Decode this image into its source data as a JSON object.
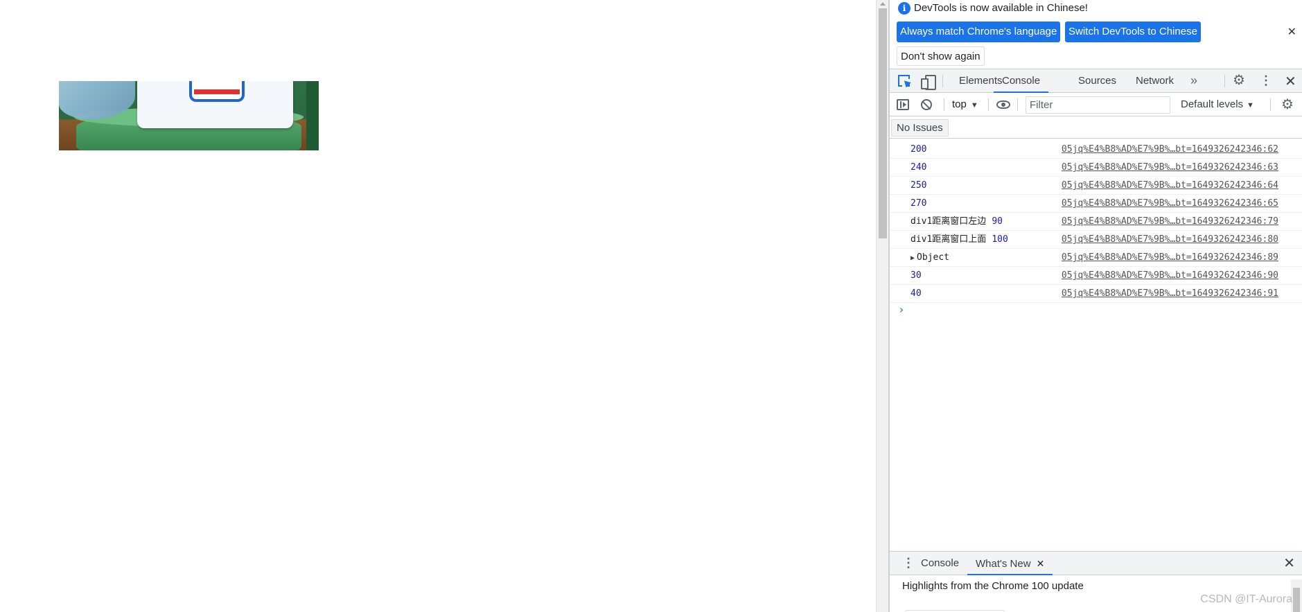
{
  "banner": {
    "message": "DevTools is now available in Chinese!",
    "match_button": "Always match Chrome's language",
    "switch_button": "Switch DevTools to Chinese",
    "dont_show_button": "Don't show again",
    "close": "✕"
  },
  "tabs": {
    "elements": "Elements",
    "console": "Console",
    "sources": "Sources",
    "network": "Network",
    "more": "»",
    "close": "✕"
  },
  "toolbar": {
    "context": "top",
    "filter_placeholder": "Filter",
    "levels": "Default levels"
  },
  "issues": {
    "label": "No Issues"
  },
  "console": {
    "messages": [
      {
        "label": "",
        "value": "200",
        "source": "05jq%E4%B8%AD%E7%9B%…bt=1649326242346:62"
      },
      {
        "label": "",
        "value": "240",
        "source": "05jq%E4%B8%AD%E7%9B%…bt=1649326242346:63"
      },
      {
        "label": "",
        "value": "250",
        "source": "05jq%E4%B8%AD%E7%9B%…bt=1649326242346:64"
      },
      {
        "label": "",
        "value": "270",
        "source": "05jq%E4%B8%AD%E7%9B%…bt=1649326242346:65"
      },
      {
        "label": "div1距离窗口左边",
        "value": "90",
        "source": "05jq%E4%B8%AD%E7%9B%…bt=1649326242346:79"
      },
      {
        "label": "div1距离窗口上面",
        "value": "100",
        "source": "05jq%E4%B8%AD%E7%9B%…bt=1649326242346:80"
      },
      {
        "label": "Object",
        "value": "",
        "source": "05jq%E4%B8%AD%E7%9B%…bt=1649326242346:89",
        "expandable": true
      },
      {
        "label": "",
        "value": "30",
        "source": "05jq%E4%B8%AD%E7%9B%…bt=1649326242346:90"
      },
      {
        "label": "",
        "value": "40",
        "source": "05jq%E4%B8%AD%E7%9B%…bt=1649326242346:91"
      }
    ],
    "prompt": "›"
  },
  "drawer": {
    "console_tab": "Console",
    "whats_new_tab": "What's New",
    "tab_close": "✕",
    "close": "✕",
    "highlight": "Highlights from the Chrome 100 update"
  },
  "watermark": "CSDN @IT-Aurora",
  "colors": {
    "accent": "#1a73e8",
    "number": "#1a1aa6"
  }
}
